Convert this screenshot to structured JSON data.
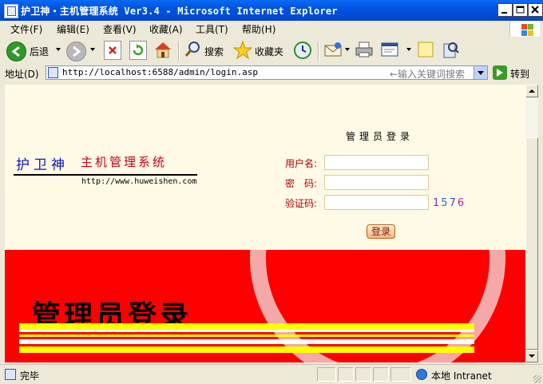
{
  "window": {
    "title": "护卫神・主机管理系统 Ver3.4 - Microsoft Internet Explorer"
  },
  "menu": [
    {
      "label": "文件(F)"
    },
    {
      "label": "编辑(E)"
    },
    {
      "label": "查看(V)"
    },
    {
      "label": "收藏(A)"
    },
    {
      "label": "工具(T)"
    },
    {
      "label": "帮助(H)"
    }
  ],
  "toolbar": {
    "back_label": "后退",
    "search_label": "搜索",
    "favorites_label": "收藏夹"
  },
  "address": {
    "label": "地址(D)",
    "url": "http://localhost:6588/admin/login.asp",
    "hint": "←输入关键词搜索",
    "go_label": "转到"
  },
  "page": {
    "logo_part1": "护卫神",
    "logo_part2": "主机管理系统",
    "logo_url": "http://www.huweishen.com",
    "login_title": "管理员登录",
    "username_label": "用户名:",
    "password_label": "密　码:",
    "captcha_label": "验证码:",
    "captcha_code": "1576",
    "login_button": "登录",
    "banner_title": "管理员登录",
    "colors": {
      "banner_red": "#fe0000",
      "stripe_yellow": "#ffff00",
      "logo_blue": "#0c17b8",
      "logo_red": "#c8001a",
      "captcha_digits": [
        "#7b2fb8",
        "#2a6ad8",
        "#3b4bb8",
        "#d0209a"
      ]
    }
  },
  "status": {
    "text": "完毕",
    "zone": "本地 Intranet"
  }
}
